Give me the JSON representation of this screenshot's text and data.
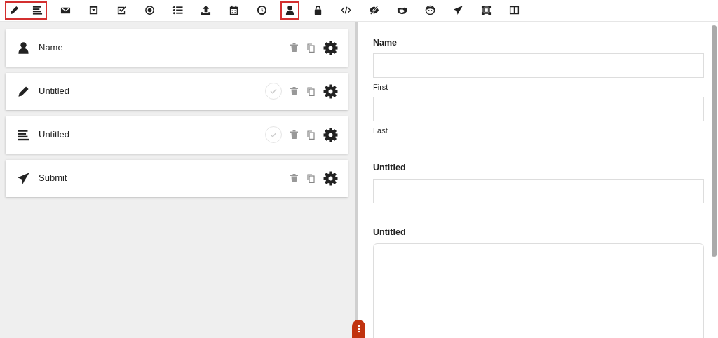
{
  "toolbar": [
    {
      "highlighted": true,
      "icons": [
        {
          "kind": "pencil"
        },
        {
          "kind": "lines"
        }
      ]
    },
    {
      "highlighted": false,
      "icons": [
        {
          "kind": "envelope"
        }
      ]
    },
    {
      "highlighted": false,
      "icons": [
        {
          "kind": "dropdown"
        }
      ]
    },
    {
      "highlighted": false,
      "icons": [
        {
          "kind": "checkbox"
        }
      ]
    },
    {
      "highlighted": false,
      "icons": [
        {
          "kind": "radio"
        }
      ]
    },
    {
      "highlighted": false,
      "icons": [
        {
          "kind": "list"
        }
      ]
    },
    {
      "highlighted": false,
      "icons": [
        {
          "kind": "upload"
        }
      ]
    },
    {
      "highlighted": false,
      "icons": [
        {
          "kind": "calendar"
        }
      ]
    },
    {
      "highlighted": false,
      "icons": [
        {
          "kind": "clock"
        }
      ]
    },
    {
      "highlighted": true,
      "icons": [
        {
          "kind": "person"
        }
      ]
    },
    {
      "highlighted": false,
      "icons": [
        {
          "kind": "lock"
        }
      ]
    },
    {
      "highlighted": false,
      "icons": [
        {
          "kind": "code"
        }
      ]
    },
    {
      "highlighted": false,
      "icons": [
        {
          "kind": "eye-slash"
        }
      ]
    },
    {
      "highlighted": false,
      "icons": [
        {
          "kind": "handshake"
        }
      ]
    },
    {
      "highlighted": false,
      "icons": [
        {
          "kind": "face"
        }
      ]
    },
    {
      "highlighted": false,
      "icons": [
        {
          "kind": "plane"
        }
      ]
    },
    {
      "highlighted": false,
      "icons": [
        {
          "kind": "frame"
        }
      ]
    },
    {
      "highlighted": false,
      "icons": [
        {
          "kind": "columns"
        }
      ]
    }
  ],
  "fields": [
    {
      "kind": "person",
      "label": "Name",
      "actions": [
        {
          "kind": "delete"
        },
        {
          "kind": "copy"
        },
        {
          "kind": "settings"
        }
      ]
    },
    {
      "kind": "pencil",
      "label": "Untitled",
      "actions": [
        {
          "kind": "check"
        },
        {
          "kind": "delete"
        },
        {
          "kind": "copy"
        },
        {
          "kind": "settings"
        }
      ]
    },
    {
      "kind": "lines",
      "label": "Untitled",
      "actions": [
        {
          "kind": "check"
        },
        {
          "kind": "delete"
        },
        {
          "kind": "copy"
        },
        {
          "kind": "settings"
        }
      ]
    },
    {
      "kind": "plane",
      "label": "Submit",
      "actions": [
        {
          "kind": "delete"
        },
        {
          "kind": "copy"
        },
        {
          "kind": "settings"
        }
      ]
    }
  ],
  "preview": [
    {
      "kind": "name",
      "label": "Name",
      "sublabels": [
        "First",
        "Last"
      ]
    },
    {
      "kind": "input",
      "label": "Untitled"
    },
    {
      "kind": "textarea",
      "label": "Untitled"
    }
  ]
}
